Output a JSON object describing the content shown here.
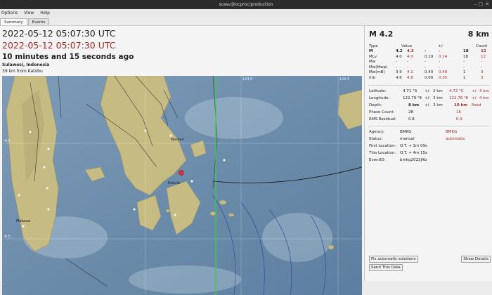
{
  "window": {
    "title": "scesv@ocproc/production"
  },
  "menu": {
    "items": [
      "Options",
      "View",
      "Help"
    ]
  },
  "tabs": [
    "Summary",
    "Events"
  ],
  "summary": {
    "time1": "2022-05-12 05:07:30 UTC",
    "time2": "2022-05-12 05:07:30 UTC",
    "ago": "10 minutes and 15 seconds ago",
    "region": "Sulawesi, Indonesia",
    "distance": "39 km from Katobu"
  },
  "map": {
    "labels": [
      "Kendari",
      "Kabula",
      "Makasar"
    ],
    "grid_labels": [
      "124 E",
      "126 E",
      "-4.5",
      "-6.5"
    ]
  },
  "magnitude": {
    "headline": "M 4.2",
    "depth_headline": "8 km"
  },
  "mag_table": {
    "headers": [
      "Type",
      "Value",
      "+/-",
      "Count"
    ],
    "rows": [
      {
        "type": "M",
        "v1": "4.2",
        "v2": "4.3",
        "e1": "-",
        "e2": "-",
        "c1": "18",
        "c2": "12"
      },
      {
        "type": "MLv",
        "v1": "4.0",
        "v2": "4.0",
        "e1": "0.19",
        "e2": "0.14",
        "c1": "18",
        "c2": "12"
      },
      {
        "type": "Mw",
        "v1": "-",
        "v2": "-",
        "e1": "-",
        "e2": "-",
        "c1": "-",
        "c2": "-"
      },
      {
        "type": "Mw(Mwp)",
        "v1": "-",
        "v2": "-",
        "e1": "-",
        "e2": "-",
        "c1": "-",
        "c2": "-"
      },
      {
        "type": "Mw(mB)",
        "v1": "3.9",
        "v2": "4.1",
        "e1": "0.40",
        "e2": "0.40",
        "c1": "1",
        "c2": "3"
      },
      {
        "type": "mb",
        "v1": "4.6",
        "v2": "4.8",
        "e1": "0.00",
        "e2": "0.35",
        "c1": "1",
        "c2": "3"
      }
    ]
  },
  "location": {
    "latitude": {
      "label": "Latitude:",
      "v1": "4.71 °S",
      "pm1": "+/-",
      "e1": "2 km",
      "v2": "4.72 °S",
      "pm2": "+/-",
      "e2": "3 km"
    },
    "longitude": {
      "label": "Longitude:",
      "v1": "122.79 °E",
      "pm1": "+/-",
      "e1": "3 km",
      "v2": "122.78 °E",
      "pm2": "+/-",
      "e2": "4 km"
    },
    "depth": {
      "label": "Depth:",
      "v1": "8 km",
      "pm1": "+/-",
      "e1": "3 km",
      "v2": "10 km",
      "e2": "fixed"
    },
    "phase_count": {
      "label": "Phase Count:",
      "v1": "28",
      "v2": "16"
    },
    "rms": {
      "label": "RMS Residual:",
      "v1": "0.8",
      "v2": "0.9"
    }
  },
  "info": {
    "agency": {
      "label": "Agency:",
      "v1": "BMKG",
      "v2": "BMKG"
    },
    "status": {
      "label": "Status:",
      "v1": "manual",
      "v2": "automatic"
    },
    "first_location": {
      "label": "First Location:",
      "v1": "O.T. + 1m 09s"
    },
    "this_location": {
      "label": "This Location:",
      "v1": "O.T. + 4m 15s"
    },
    "event_id": {
      "label": "EventID:",
      "v1": "bmkg2022jftb"
    }
  },
  "buttons": {
    "fix": "Fix automatic solutions",
    "show_details": "Show Details",
    "send": "Send This Data"
  },
  "colors": {
    "accent_red": "#a52a2a",
    "epicenter": "#e2303a",
    "map_sea": "#6f8fad",
    "map_land": "#c8bd85"
  }
}
